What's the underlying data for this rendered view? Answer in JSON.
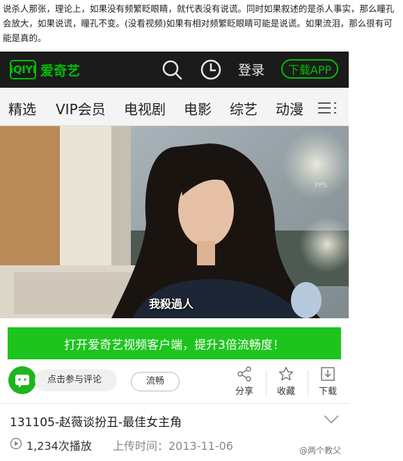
{
  "caption": "说杀人那张，理论上，如果没有频繁眨眼睛，就代表没有说谎。同时如果叙述的是杀人事实，那么瞳孔会放大，如果说谎，瞳孔不变。(没看视频)如果有相对频繁眨眼睛可能是说谎。如果流泪，那么很有可能是真的。",
  "header": {
    "logo_mark": "iQIYI",
    "logo_text": "爱奇艺",
    "login_label": "登录",
    "download_app_label": "下载APP"
  },
  "nav": {
    "items": [
      "精选",
      "VIP会员",
      "电视剧",
      "电影",
      "综艺",
      "动漫"
    ]
  },
  "video": {
    "subtitle_text": "我殺過人",
    "corner_logo": "PPS"
  },
  "banner": {
    "label": "打开爱奇艺视频客户端，提升3倍流畅度！"
  },
  "actions": {
    "comment_placeholder": "点击参与评论",
    "fluency_label": "流畅",
    "share_label": "分享",
    "favorite_label": "收藏",
    "download_label": "下载"
  },
  "video_info": {
    "title": "131105-赵薇谈扮丑-最佳女主角",
    "play_count": "1,234次播放",
    "upload_time": "上传时间：2013-11-06"
  },
  "watermark": "@两个教父",
  "colors": {
    "brand_green": "#00be06",
    "banner_green": "#1ec41e",
    "header_bg": "#1b1b1b"
  }
}
